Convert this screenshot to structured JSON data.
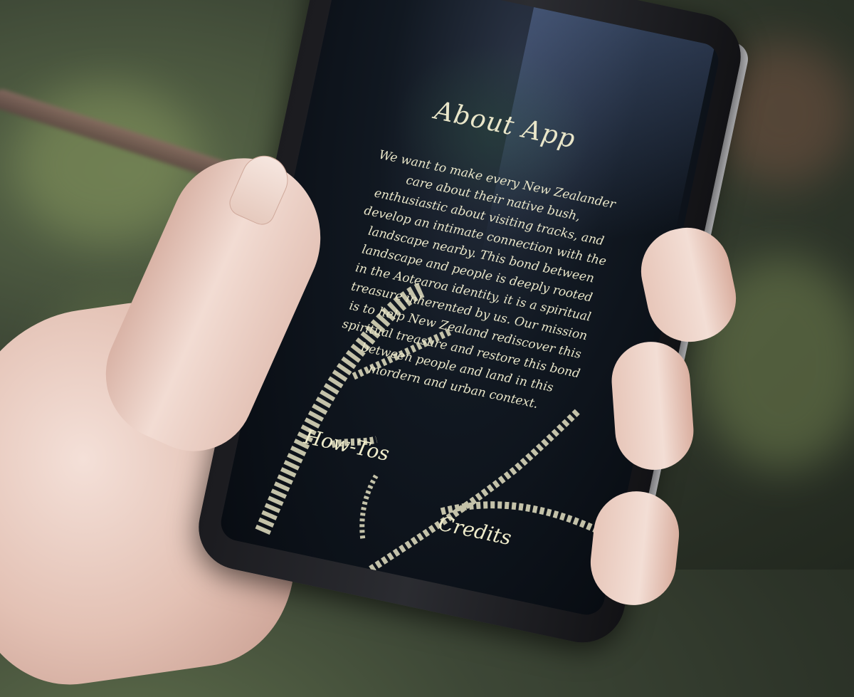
{
  "app": {
    "title": "About App",
    "description": "We want to make every New Zealander care about their native bush, enthusiastic about visiting tracks, and develop an intimate connection with the landscape nearby. This bond between landscape and people is deeply rooted in the Aotearoa identity, it is a spiritual treasure inherented by us. Our mission is to help New Zealand rediscover this spiritual treasure and restore this bond between people and land in this mordern and urban context.",
    "nav": {
      "howtos_label": "How-Tos",
      "credits_label": "Credits"
    }
  },
  "colors": {
    "text": "#e9e6c9",
    "screen_bg": "#111821"
  }
}
